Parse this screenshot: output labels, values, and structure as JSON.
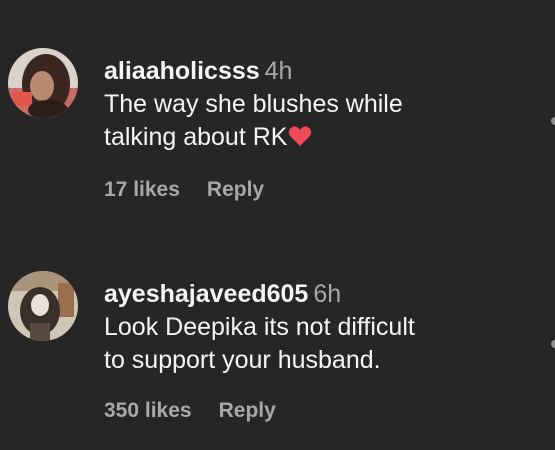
{
  "comments": [
    {
      "username": "aliaaholicsss",
      "time": "4h",
      "text_line1": "The way she blushes while",
      "text_line2": "talking about RK",
      "emoji": "red-heart",
      "likes": "17 likes",
      "reply": "Reply"
    },
    {
      "username": "ayeshajaveed605",
      "time": "6h",
      "text_line1": "Look Deepika its not difficult",
      "text_line2": "to support your husband.",
      "likes": "350 likes",
      "reply": "Reply"
    }
  ],
  "colors": {
    "background": "#262626",
    "primary_text": "#f5f5f5",
    "secondary_text": "#a8a8a8",
    "heart": "#ed4956"
  },
  "icons": {
    "heart_emoji": "heart-emoji-icon",
    "scroll_indicator": "dot"
  }
}
